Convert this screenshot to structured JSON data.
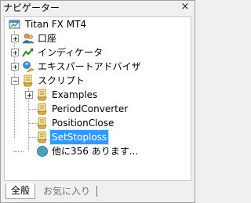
{
  "window": {
    "title": "ナビゲーター",
    "close_glyph": "×"
  },
  "tree": {
    "root": {
      "label": "Titan FX MT4",
      "icon": "mt4-terminal-icon"
    },
    "accounts": {
      "label": "口座",
      "icon": "accounts-icon",
      "expanded": false
    },
    "indicators": {
      "label": "インディケータ",
      "icon": "indicators-icon",
      "expanded": false
    },
    "experts": {
      "label": "エキスパートアドバイザ",
      "icon": "expert-advisors-icon",
      "expanded": false
    },
    "scripts": {
      "label": "スクリプト",
      "icon": "scripts-icon",
      "expanded": true,
      "children": [
        {
          "label": "Examples",
          "icon": "script-folder-icon",
          "expandable": true
        },
        {
          "label": "PeriodConverter",
          "icon": "script-icon"
        },
        {
          "label": "PositionClose",
          "icon": "script-icon"
        },
        {
          "label": "SetStoploss",
          "icon": "script-icon",
          "selected": true
        }
      ]
    },
    "more": {
      "label": "他に356 あります...",
      "icon": "globe-icon"
    }
  },
  "tabs": [
    {
      "label": "全般",
      "active": true
    },
    {
      "label": "お気に入り",
      "active": false
    }
  ],
  "colors": {
    "selection": "#3399ff",
    "background": "#f0f0f0"
  }
}
